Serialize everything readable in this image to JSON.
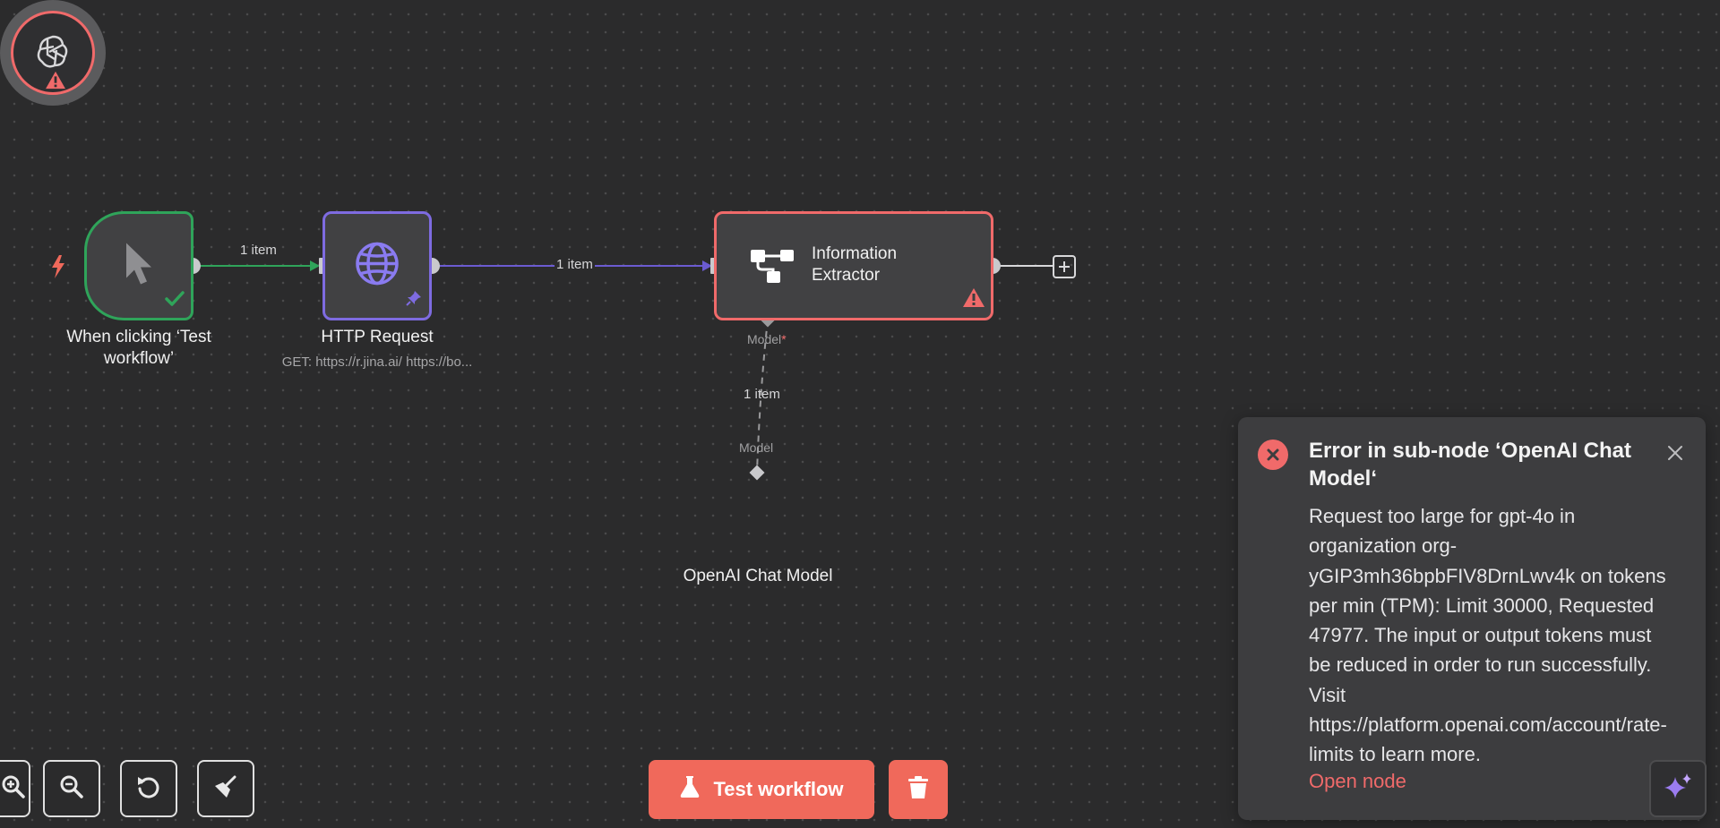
{
  "canvas": {
    "edges": [
      {
        "id": "trigger-to-http",
        "label": "1 item",
        "color": "#2fa45a"
      },
      {
        "id": "http-to-extractor",
        "label": "1 item",
        "color": "#6b5bd1"
      },
      {
        "id": "model-to-extractor",
        "label": "1 item",
        "color": "#8a8a8c"
      }
    ]
  },
  "nodes": {
    "trigger": {
      "label": "When clicking ‘Test workflow’",
      "icon": "cursor-icon",
      "status": "success",
      "accent": "#2fa45a"
    },
    "http": {
      "label": "HTTP Request",
      "subtitle": "GET: https://r.jina.ai/ https://bo...",
      "icon": "globe-icon",
      "pinned": true,
      "accent": "#7e6be1"
    },
    "extractor": {
      "label": "Information Extractor",
      "icon": "extractor-icon",
      "status": "warning",
      "accent": "#f06a6a",
      "model_handle_label": "Model",
      "model_handle_required": "*"
    },
    "openai": {
      "label": "OpenAI Chat Model",
      "icon": "openai-icon",
      "status": "warning",
      "handle_label": "Model"
    }
  },
  "controls": {
    "zoom_in": "zoom-in-icon",
    "zoom_out": "zoom-out-icon",
    "reset": "reset-zoom-icon",
    "tidy": "broom-icon"
  },
  "actions": {
    "test_workflow_label": "Test workflow",
    "delete_icon": "trash-icon",
    "accent": "#f0695b"
  },
  "toast": {
    "title": "Error in sub-node ‘OpenAI Chat Model‘",
    "message": "Request too large for gpt-4o in organization org-yGIP3mh36bpbFIV8DrnLwv4k on tokens per min (TPM): Limit 30000, Requested 47977. The input or output tokens must be reduced in order to run successfully. Visit https://platform.openai.com/account/rate-limits to learn more.",
    "link_label": "Open node",
    "error_color": "#f06a6a"
  }
}
